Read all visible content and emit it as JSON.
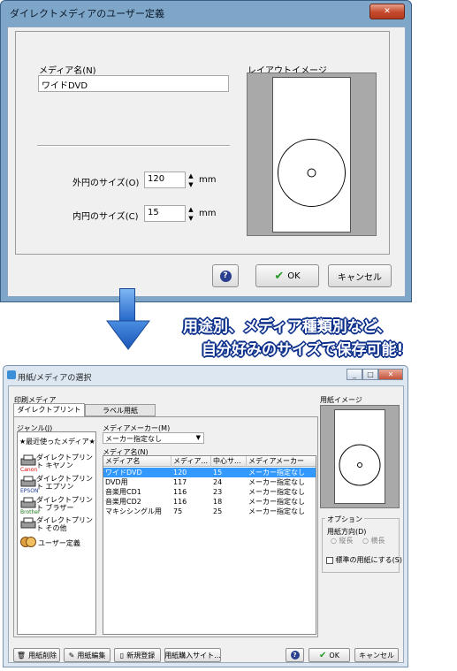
{
  "top_dialog": {
    "title": "ダイレクトメディアのユーザー定義",
    "close_glyph": "✕",
    "media_name_label": "メディア名(N)",
    "media_name_value": "ワイドDVD",
    "layout_image_label": "レイアウトイメージ",
    "outer_size_label": "外円のサイズ(O)",
    "outer_size_value": "120",
    "inner_size_label": "内円のサイズ(C)",
    "inner_size_value": "15",
    "unit": "mm",
    "help_glyph": "?",
    "ok_label": "OK",
    "cancel_label": "キャンセル"
  },
  "caption": {
    "line1": "用途別、メディア種類別など、",
    "line2": "自分好みのサイズで保存可能!"
  },
  "bottom_dialog": {
    "title": "用紙/メディアの選択",
    "print_media_label": "印刷メディア",
    "tabs": [
      "ダイレクトプリント",
      "ラベル用紙"
    ],
    "genre_label": "ジャンル(J)",
    "genres": [
      {
        "label": "★最近使ったメディア★",
        "icon": "star-icon"
      },
      {
        "label": "ダイレクトプリント キヤノン",
        "sub": "Canon",
        "icon": "printer-icon"
      },
      {
        "label": "ダイレクトプリント エプソン",
        "sub": "EPSON",
        "icon": "printer-icon"
      },
      {
        "label": "ダイレクトプリント ブラザー",
        "sub": "Brother",
        "icon": "printer-icon"
      },
      {
        "label": "ダイレクトプリント その他",
        "sub": "",
        "icon": "printer-icon"
      },
      {
        "label": "ユーザー定義",
        "icon": "user-faces-icon"
      }
    ],
    "maker_label": "メディアメーカー(M)",
    "maker_value": "メーカー指定なし",
    "media_name_label": "メディア名(N)",
    "columns": [
      "メディア名",
      "メディア...",
      "中心サ...",
      "メディアメーカー"
    ],
    "rows": [
      [
        "ワイドDVD",
        "120",
        "15",
        "メーカー指定なし"
      ],
      [
        "DVD用",
        "117",
        "24",
        "メーカー指定なし"
      ],
      [
        "音楽用CD1",
        "116",
        "23",
        "メーカー指定なし"
      ],
      [
        "音楽用CD2",
        "116",
        "18",
        "メーカー指定なし"
      ],
      [
        "マキシシングル用",
        "75",
        "25",
        "メーカー指定なし"
      ]
    ],
    "selected_row": 0,
    "paper_image_label": "用紙イメージ",
    "options_label": "オプション",
    "orientation_label": "用紙方向(D)",
    "portrait_label": "縦長",
    "landscape_label": "横長",
    "standard_paper_label": "標準の用紙にする(S)",
    "buttons": {
      "delete": "用紙削除",
      "edit": "用紙編集",
      "new": "新規登録",
      "purchase": "用紙購入サイト...",
      "help": "?",
      "ok": "OK",
      "cancel": "キャンセル"
    },
    "window_buttons": [
      "_",
      "□",
      "✕"
    ]
  }
}
